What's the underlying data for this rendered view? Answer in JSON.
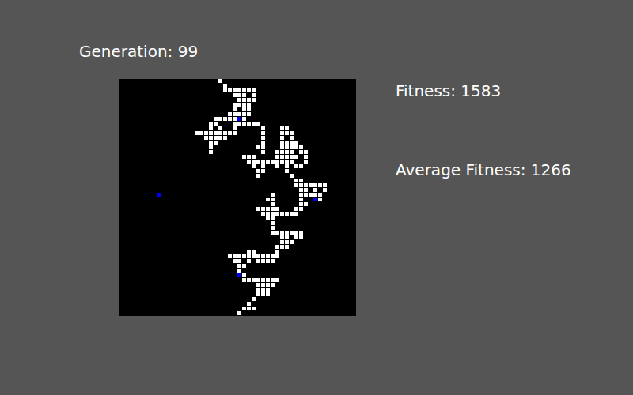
{
  "title": "Generation: 99",
  "stats": [
    {
      "label": "Fitness: 1583"
    },
    {
      "label": "Average Fitness: 1266"
    }
  ],
  "grid": {
    "cols": 50,
    "rows": 50,
    "path_rows": [
      [
        21
      ],
      [
        22
      ],
      [
        22,
        23,
        24,
        25,
        26,
        27,
        28
      ],
      [
        24,
        25,
        26,
        28
      ],
      [
        25,
        26,
        27,
        28
      ],
      [
        24,
        25,
        26,
        27
      ],
      [
        24,
        26,
        27
      ],
      [
        23,
        24,
        25,
        26,
        27
      ],
      [
        20,
        21,
        22,
        23,
        24,
        26
      ],
      [
        19,
        20,
        24,
        25,
        26,
        27,
        28,
        29
      ],
      [
        19,
        21,
        24,
        30,
        34,
        35
      ],
      [
        16,
        17,
        18,
        19,
        20,
        21,
        22,
        23,
        24,
        30,
        34,
        35,
        36
      ],
      [
        18,
        19,
        20,
        21,
        22,
        30,
        34,
        36
      ],
      [
        19,
        20,
        30,
        34,
        35,
        36,
        37
      ],
      [
        19,
        29,
        30,
        34,
        35,
        36,
        37,
        38
      ],
      [
        19,
        30,
        33,
        34,
        35,
        36,
        38,
        39
      ],
      [
        26,
        27,
        28,
        33,
        34,
        35,
        36,
        37,
        39
      ],
      [
        27,
        28,
        29,
        30,
        31,
        32,
        33,
        34,
        35,
        36,
        39
      ],
      [
        28,
        30,
        33,
        35,
        37,
        38
      ],
      [
        29,
        30,
        35
      ],
      [
        29,
        36
      ],
      [
        37,
        38
      ],
      [
        37,
        38,
        39,
        40,
        41,
        42,
        43
      ],
      [
        38,
        39,
        41,
        43
      ],
      [
        32,
        38,
        39,
        40,
        41,
        42
      ],
      [
        31,
        32,
        38,
        42
      ],
      [
        32,
        38,
        39
      ],
      [
        29,
        30,
        31,
        32,
        33,
        37,
        38
      ],
      [
        30,
        31,
        32,
        33,
        34,
        35,
        36,
        37
      ],
      [
        31,
        32
      ],
      [
        32
      ],
      [
        32
      ],
      [
        32,
        33,
        34,
        35,
        36,
        37,
        38
      ],
      [
        34,
        35,
        37,
        38
      ],
      [
        34,
        35,
        36
      ],
      [
        33,
        34,
        35
      ],
      [
        27,
        28,
        33
      ],
      [
        23,
        24,
        25,
        26,
        27,
        28,
        29,
        30,
        31,
        32,
        33
      ],
      [
        24,
        25,
        27,
        29,
        30,
        31,
        32
      ],
      [
        25,
        26
      ],
      [
        25
      ],
      [
        26
      ],
      [
        26,
        27,
        28,
        29,
        30,
        31,
        32,
        33
      ],
      [
        29,
        30,
        31,
        32
      ],
      [
        29,
        30,
        31
      ],
      [
        29,
        30,
        31
      ],
      [
        28
      ],
      [
        27
      ],
      [
        26,
        27,
        28
      ],
      [
        25
      ]
    ],
    "markers": [
      [
        8,
        24
      ],
      [
        25,
        8
      ],
      [
        41,
        25
      ],
      [
        25,
        41
      ]
    ]
  }
}
